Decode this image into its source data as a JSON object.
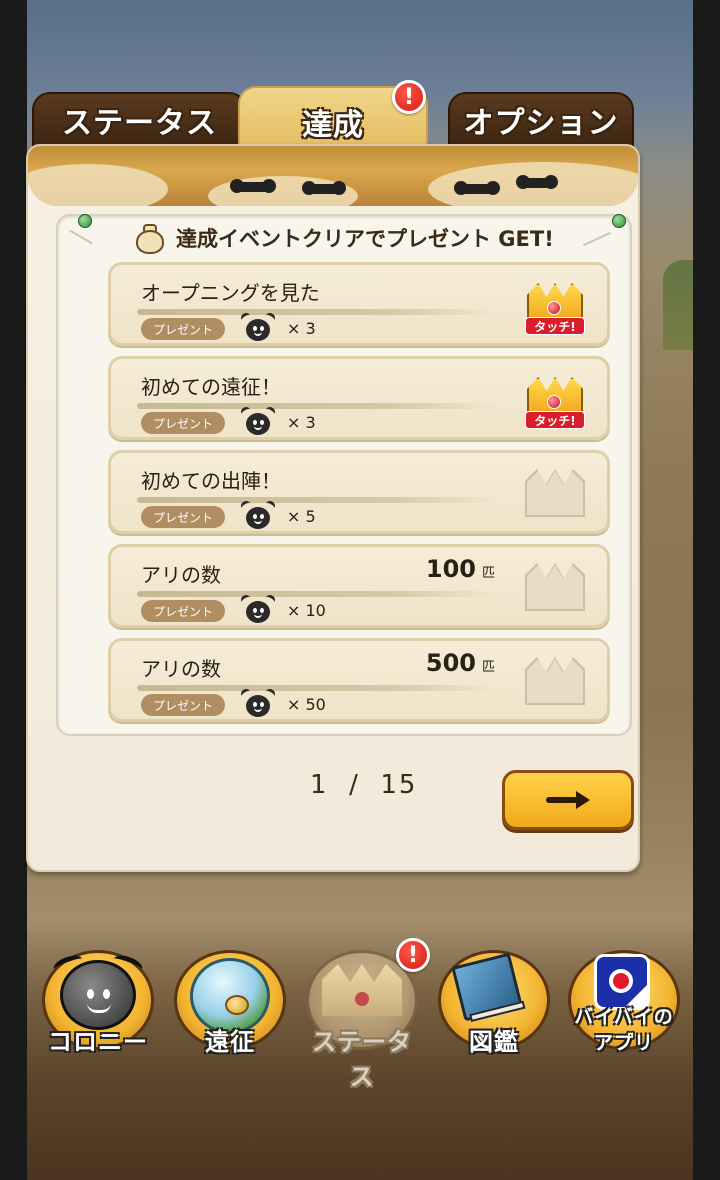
{
  "tabs": [
    {
      "label": "ステータス"
    },
    {
      "label": "達成",
      "alert": "!"
    },
    {
      "label": "オプション"
    }
  ],
  "banner": {
    "text": "達成イベントクリアでプレゼント GET!"
  },
  "achievements": [
    {
      "title": "オープニングを見た",
      "count": "",
      "unit": "",
      "present_label": "プレゼント",
      "reward_qty": "× 3",
      "state": "claimable",
      "touch_label": "タッチ!"
    },
    {
      "title": "初めての遠征！",
      "count": "",
      "unit": "",
      "present_label": "プレゼント",
      "reward_qty": "× 3",
      "state": "claimable",
      "touch_label": "タッチ!"
    },
    {
      "title": "初めての出陣！",
      "count": "",
      "unit": "",
      "present_label": "プレゼント",
      "reward_qty": "× 5",
      "state": "locked",
      "touch_label": ""
    },
    {
      "title": "アリの数",
      "count": "100",
      "unit": "匹",
      "present_label": "プレゼント",
      "reward_qty": "× 10",
      "state": "locked",
      "touch_label": ""
    },
    {
      "title": "アリの数",
      "count": "500",
      "unit": "匹",
      "present_label": "プレゼント",
      "reward_qty": "× 50",
      "state": "locked",
      "touch_label": ""
    }
  ],
  "pager": {
    "current": "1",
    "separator": "/",
    "total": "15"
  },
  "nav": [
    {
      "label": "コロニー"
    },
    {
      "label": "遠征"
    },
    {
      "label": "ステータス",
      "alert": "!"
    },
    {
      "label": "図鑑"
    },
    {
      "label_line1": "バイバイの",
      "label_line2": "アプリ"
    }
  ],
  "colors": {
    "accent": "#f2a91a",
    "alert": "#d11a10",
    "panel": "#f6f1e4"
  }
}
